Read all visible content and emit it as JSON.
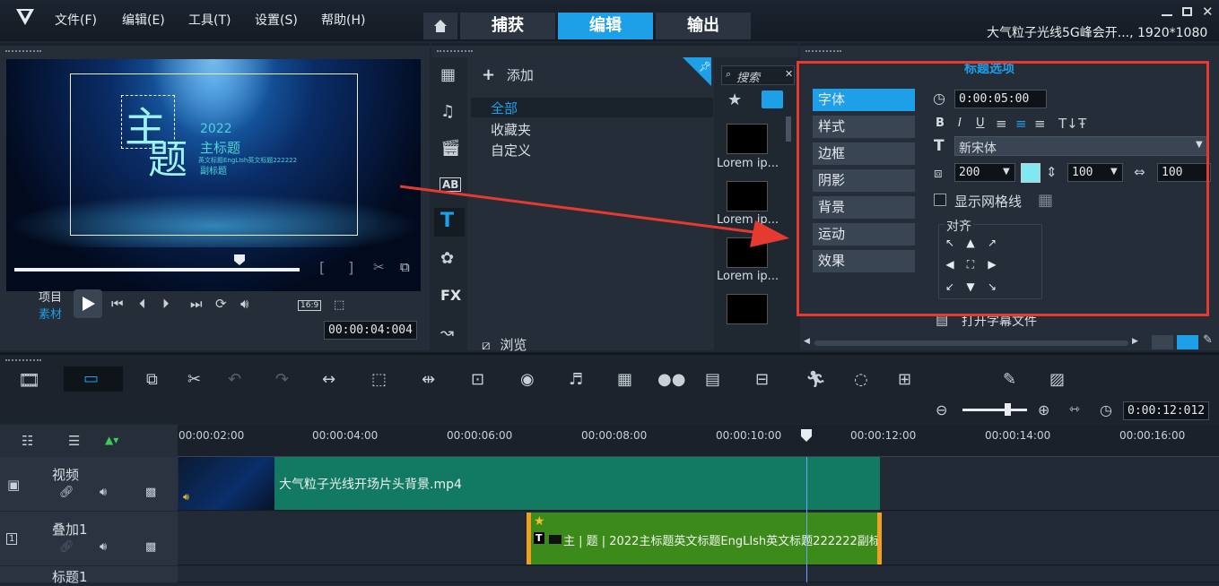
{
  "menu": [
    "文件(F)",
    "编辑(E)",
    "工具(T)",
    "设置(S)",
    "帮助(H)"
  ],
  "tabs": [
    "捕获",
    "编辑",
    "输出"
  ],
  "project_title": "大气粒子光线5G峰会开..., 1920*1080",
  "preview": {
    "title_main_1": "主",
    "title_main_2": "题",
    "year": "2022",
    "main_title": "主标题",
    "english": "英文标题EngLIsh英文标题222222",
    "subtitle": "副标题",
    "mode_project": "项目",
    "mode_clip": "素材",
    "aspect": "16:9",
    "timecode": "00:00:04:004"
  },
  "library": {
    "add_label": "添加",
    "folders": [
      "全部",
      "收藏夹",
      "自定义"
    ],
    "browse_label": "浏览",
    "search_placeholder": "搜索",
    "thumb_label": "Lorem ip..."
  },
  "title_options": {
    "heading": "标题选项",
    "categories": [
      "字体",
      "样式",
      "边框",
      "阴影",
      "背景",
      "运动",
      "效果"
    ],
    "duration": "0:00:05:00",
    "font": "新宋体",
    "size": "200",
    "line_spacing": "100",
    "char_spacing": "100",
    "show_grid": "显示网格线",
    "align_label": "对齐",
    "open_subtitle": "打开字幕文件",
    "text_color": "#7fe8f0"
  },
  "timeline": {
    "timecode": "0:00:12:012",
    "ticks": [
      "00:00:02:00",
      "00:00:04:00",
      "00:00:06:00",
      "00:00:08:00",
      "00:00:10:00",
      "00:00:12:00",
      "00:00:14:00",
      "00:00:16:00"
    ],
    "tracks": [
      "视频",
      "叠加1",
      "标题1"
    ],
    "video_clip": "大气粒子光线开场片头背景.mp4",
    "overlay_clip": "主 | 题 | 2022主标题英文标题EngLIsh英文标题222222副标"
  },
  "colors": {
    "accent": "#1ea0e8",
    "annotation": "#e53a30",
    "video_clip": "#127a62",
    "overlay_clip": "#3c8a19"
  }
}
